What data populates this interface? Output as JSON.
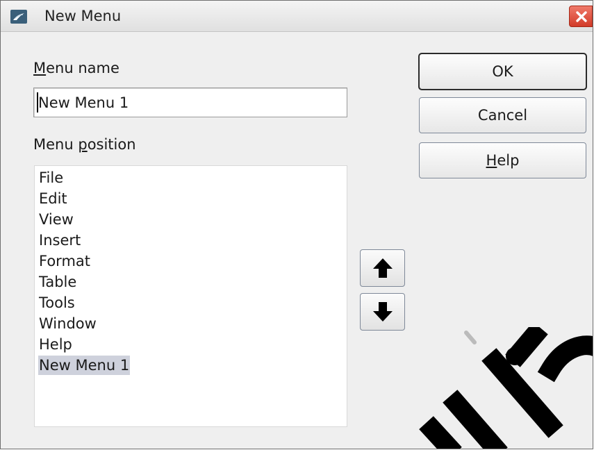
{
  "dialog": {
    "title": "New Menu",
    "app_icon": "libreoffice-icon",
    "close_icon": "close-x-icon"
  },
  "menu_name": {
    "label": "Menu name",
    "mnemonic": "M",
    "value": "New Menu 1"
  },
  "menu_position": {
    "label_before": "Menu ",
    "label_mnemonic": "p",
    "label_after": "osition",
    "items": [
      "File",
      "Edit",
      "View",
      "Insert",
      "Format",
      "Table",
      "Tools",
      "Window",
      "Help",
      "New Menu 1"
    ],
    "selected_index": 9
  },
  "buttons": {
    "ok": "OK",
    "cancel": "Cancel",
    "help": "Help"
  },
  "move_buttons": {
    "up_icon": "arrow-up-icon",
    "down_icon": "arrow-down-icon"
  },
  "colors": {
    "selection": "#ced1dc",
    "close_button": "#d23b28"
  }
}
